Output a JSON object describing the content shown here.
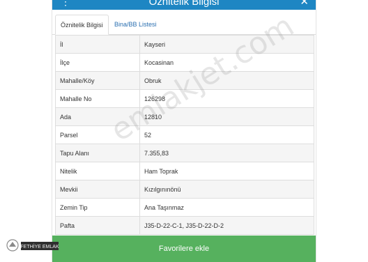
{
  "panel": {
    "title": "Öznitelik Bilgisi",
    "left_icon": "info-icon",
    "close_icon": "close-icon"
  },
  "tabs": [
    {
      "label": "Öznitelik Bilgisi",
      "active": true
    },
    {
      "label": "Bina/BB Listesi",
      "active": false
    }
  ],
  "attributes": [
    {
      "label": "İl",
      "value": "Kayseri"
    },
    {
      "label": "İlçe",
      "value": "Kocasinan"
    },
    {
      "label": "Mahalle/Köy",
      "value": "Obruk"
    },
    {
      "label": "Mahalle No",
      "value": "126298"
    },
    {
      "label": "Ada",
      "value": "12810"
    },
    {
      "label": "Parsel",
      "value": "52"
    },
    {
      "label": "Tapu Alanı",
      "value": "7.355,83"
    },
    {
      "label": "Nitelik",
      "value": "Ham Toprak"
    },
    {
      "label": "Mevkii",
      "value": "Kızılgınınönü"
    },
    {
      "label": "Zemin Tip",
      "value": "Ana Taşınmaz"
    },
    {
      "label": "Pafta",
      "value": "J35-D-22-C-1, J35-D-22-D-2"
    }
  ],
  "favorites_button": "Favorilere ekle",
  "watermark": "emlakjet.com",
  "logo_text": "FETHİYE EMLAK",
  "colors": {
    "header": "#1e86c3",
    "button": "#56b15e",
    "tab_link": "#2a6fb0"
  }
}
